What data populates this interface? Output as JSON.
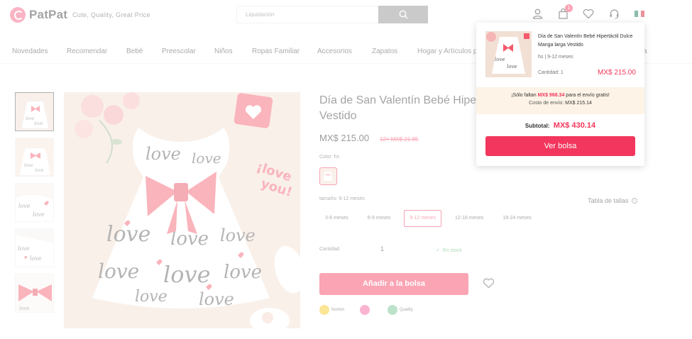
{
  "header": {
    "logo_name": "PatPat",
    "tagline": "Cute, Quality, Great Price",
    "search_placeholder": "Liquidación",
    "cart_count": "1",
    "flag_colors": [
      "#006847",
      "#ffffff",
      "#ce1126"
    ]
  },
  "nav": {
    "items": [
      "Novedades",
      "Recomendar",
      "Bebé",
      "Preescolar",
      "Niños",
      "Ropas Familiar",
      "Accesorios",
      "Zapatos",
      "Hogar y Artículos p"
    ],
    "overflow_fragment": "a"
  },
  "product": {
    "title": "Día de San Valentín Bebé Hipe",
    "title_line2": "Vestido",
    "price": "MX$ 215.00",
    "installments": "12× MX$ 21.85",
    "color_label": "Color: hs",
    "size_label": "tamaño: 9-12 meses",
    "size_chart": "Tabla de tallas",
    "sizes": [
      "3-6 meses",
      "6-9 meses",
      "9-12 meses",
      "12-18 meses",
      "18-24 meses"
    ],
    "selected_size": "9-12 meses",
    "qty_label": "Cantidad",
    "qty_value": "1",
    "stock": "En stock",
    "add_to_bag": "Añadir a la bolsa",
    "badges": [
      "Norton",
      "",
      "Quality"
    ]
  },
  "mini_cart": {
    "item_title": "Día de San Valentín Bebé Hipertáctil Dulce Manga larga Vestido",
    "item_variant": "hs | 9-12 meses",
    "item_qty": "Cantidad: 1",
    "item_price": "MX$ 215.00",
    "shipping_prefix": "¡Sólo faltan",
    "shipping_amount": "MX$ 968.34",
    "shipping_suffix": "para el envío gratis!",
    "shipping_cost_label": "Costo de envío:",
    "shipping_cost_value": "MX$ 215.14",
    "subtotal_label": "Subtotal:",
    "subtotal_value": "MX$ 430.14",
    "view_bag": "Ver bolsa"
  },
  "colors": {
    "accent": "#f2365d",
    "heart": "#f45a6a"
  }
}
